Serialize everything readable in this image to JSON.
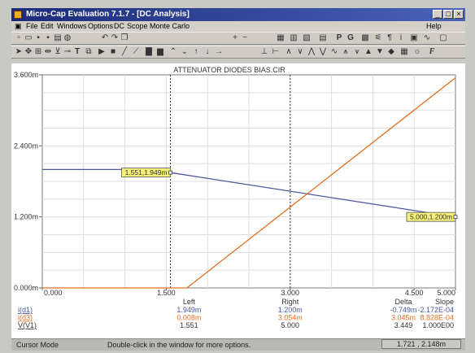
{
  "window": {
    "title": "Micro-Cap Evaluation 7.1.7 - [DC Analysis]",
    "controls": [
      "_",
      "□",
      "×"
    ]
  },
  "menu": {
    "items": [
      "File",
      "Edit",
      "Windows",
      "Options",
      "DC",
      "Scope",
      "Monte Carlo"
    ],
    "help": "Help"
  },
  "toolbar_letters": [
    "P",
    "G",
    "F"
  ],
  "chart_data": {
    "type": "line",
    "title": "ATTENUATOR DIODES BIAS.CIR",
    "xlim": [
      0,
      5.0
    ],
    "ylim": [
      0,
      3.6
    ],
    "x_ticks": [
      "0.000",
      "1.500",
      "3.000",
      "4.500",
      "5.000"
    ],
    "y_ticks": [
      "0.000m",
      "1.200m",
      "2.400m",
      "3.600m"
    ],
    "grid": true,
    "series": [
      {
        "name": "i(d1)",
        "color": "#4a5aa0",
        "points": [
          [
            0,
            2.0
          ],
          [
            1.5,
            2.0
          ],
          [
            1.551,
            1.949
          ],
          [
            5.0,
            1.2
          ]
        ]
      },
      {
        "name": "i(d3)",
        "color": "#e07020",
        "points": [
          [
            0,
            0.0
          ],
          [
            1.5,
            0.0
          ],
          [
            1.75,
            0.0
          ],
          [
            5.0,
            3.55
          ]
        ]
      }
    ],
    "cursor_labels": [
      {
        "text": "1.551,1.949m",
        "x": 1.551,
        "y": 1.949
      },
      {
        "text": "5.000,1.200m",
        "x": 5.0,
        "y": 1.2
      }
    ],
    "cursors": {
      "left_x": 1.551,
      "right_x": 3.0
    },
    "table": {
      "headers": [
        "Left",
        "Right",
        "Delta",
        "Slope"
      ],
      "rows": [
        {
          "name": "i(d1)",
          "values": [
            "1.949m",
            "1.200m",
            "-0.749m",
            "-2.172E-04"
          ],
          "color": "#4a5aa0"
        },
        {
          "name": "i(d3)",
          "values": [
            "0.008m",
            "3.054m",
            "3.045m",
            "8.828E-04"
          ],
          "color": "#e07020"
        },
        {
          "name": "V(V1)",
          "values": [
            "1.551",
            "5.000",
            "3.449",
            "1.000E00"
          ],
          "color": "#333333"
        }
      ]
    }
  },
  "status": {
    "mode": "Cursor Mode",
    "hint": "Double-click in the window for more options.",
    "coords": "1.721 , 2.148m"
  }
}
